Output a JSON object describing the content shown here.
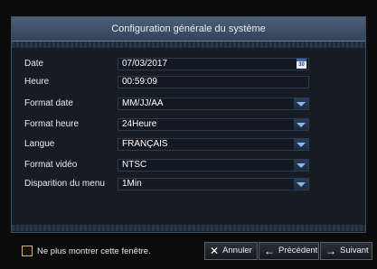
{
  "dialog": {
    "title": "Configuration générale du système"
  },
  "fields": [
    {
      "label": "Date",
      "value": "07/03/2017",
      "control": "date"
    },
    {
      "label": "Heure",
      "value": "00:59:09",
      "control": "text"
    },
    {
      "label": "Format date",
      "value": "MM/JJ/AA",
      "control": "dropdown"
    },
    {
      "label": "Format heure",
      "value": "24Heure",
      "control": "dropdown"
    },
    {
      "label": "Langue",
      "value": "FRANÇAIS",
      "control": "dropdown"
    },
    {
      "label": "Format vidéo",
      "value": "NTSC",
      "control": "dropdown"
    },
    {
      "label": "Disparition du menu",
      "value": "1Min",
      "control": "dropdown"
    }
  ],
  "calendar_icon_text": "30",
  "footer": {
    "checkbox_label": "Ne plus montrer cette fenêtre.",
    "checkbox_checked": false,
    "buttons": [
      {
        "icon": "close-icon",
        "glyph": "✕",
        "label": "Annuler"
      },
      {
        "icon": "arrow-left-icon",
        "glyph": "←",
        "label": "Précédent"
      },
      {
        "icon": "arrow-right-icon",
        "glyph": "→",
        "label": "Suivant"
      }
    ]
  },
  "colors": {
    "accent": "#3b67b6",
    "checkbox_border": "#e0b64d",
    "title_bar": "#4d6079"
  }
}
